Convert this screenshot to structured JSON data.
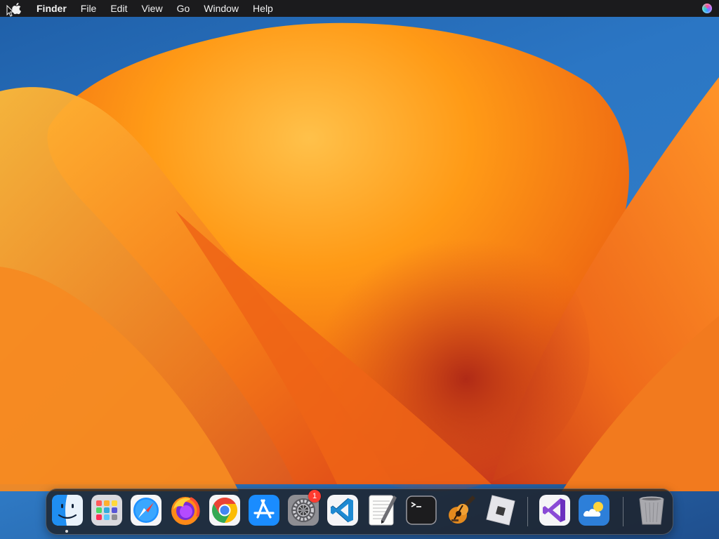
{
  "menubar": {
    "apple_icon": "apple-logo-icon",
    "app_name": "Finder",
    "items": [
      "File",
      "Edit",
      "View",
      "Go",
      "Window",
      "Help"
    ],
    "right_icon": "siri-icon"
  },
  "dock": {
    "apps": [
      {
        "icon": "finder-icon",
        "running": true
      },
      {
        "icon": "launchpad-icon"
      },
      {
        "icon": "safari-icon"
      },
      {
        "icon": "firefox-icon"
      },
      {
        "icon": "chrome-icon"
      },
      {
        "icon": "app-store-icon"
      },
      {
        "icon": "system-preferences-icon",
        "badge": "1"
      },
      {
        "icon": "vscode-icon"
      },
      {
        "icon": "textedit-icon"
      },
      {
        "icon": "terminal-icon"
      },
      {
        "icon": "garageband-icon"
      },
      {
        "icon": "roblox-icon"
      },
      {
        "icon": "visual-studio-icon"
      },
      {
        "icon": "weather-icon"
      },
      {
        "icon": "trash-icon"
      }
    ]
  },
  "colors": {
    "menubar_bg": "#1b1b1d",
    "wallpaper_blue": "#2b76c4",
    "wallpaper_orange": "#ff9a1a",
    "badge_red": "#ff3b30"
  }
}
